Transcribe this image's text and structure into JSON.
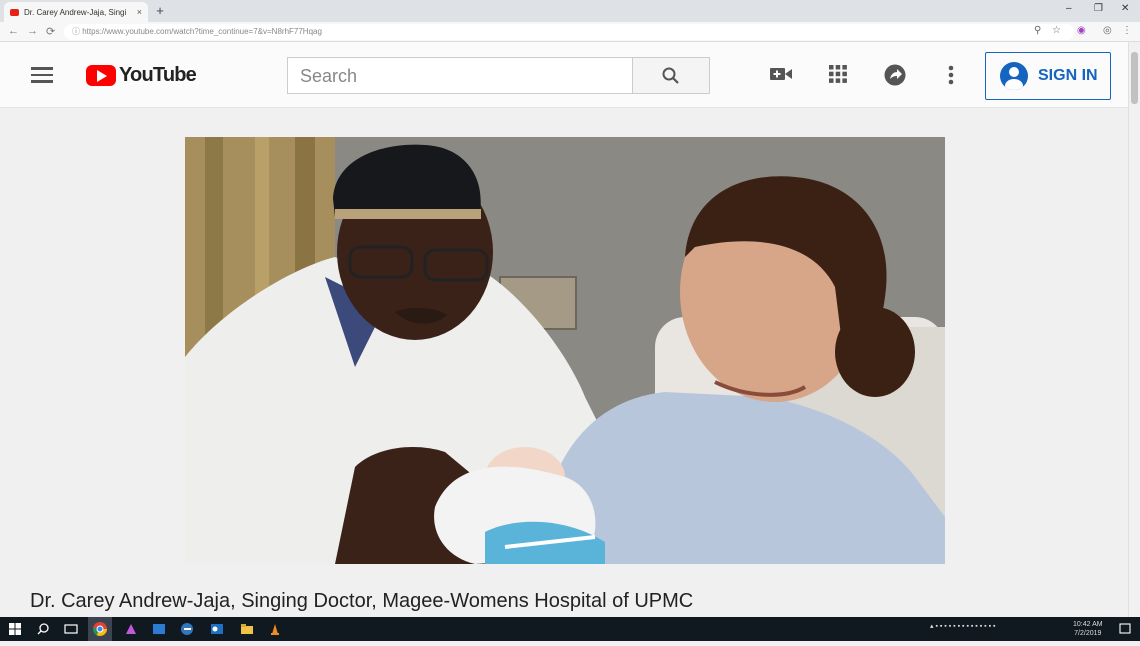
{
  "browser": {
    "tab_title": "Dr. Carey Andrew-Jaja, Singi",
    "tab_close": "×",
    "new_tab": "+",
    "url": "https://www.youtube.com/watch?time_continue=7&v=N8rhF77Hqag",
    "nav": {
      "back": "←",
      "forward": "→",
      "reload": "⟳",
      "lock": "ⓘ"
    },
    "window": {
      "minimize": "–",
      "restore": "❐",
      "close": "✕"
    },
    "omni_icons": {
      "zoom": "⚲",
      "star": "☆",
      "ext": "◉",
      "profile": "◎",
      "menu": "⋮"
    }
  },
  "youtube": {
    "logo_text": "YouTube",
    "search_placeholder": "Search",
    "sign_in": "SIGN IN",
    "icons": [
      "menu-icon",
      "create-video-icon",
      "apps-grid-icon",
      "share-arrow-icon",
      "more-vert-icon"
    ]
  },
  "video": {
    "caption": "Dr. Carey Andrew-Jaja, Singing Doctor, Magee-Womens Hospital of UPMC"
  },
  "taskbar": {
    "clock_time": "10:42 AM",
    "clock_date": "7/2/2019"
  },
  "colors": {
    "brand_red": "#ff0000",
    "link_blue": "#1565c0"
  }
}
